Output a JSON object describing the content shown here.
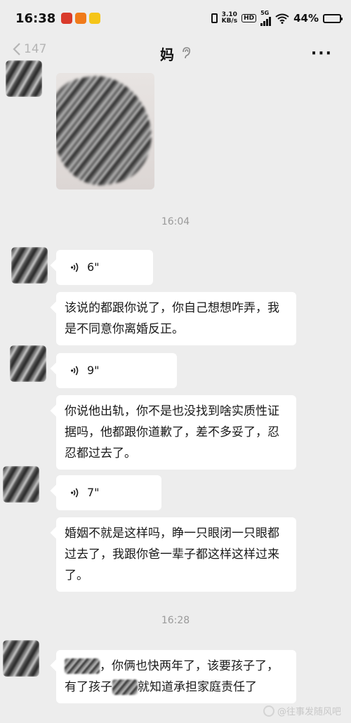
{
  "status_bar": {
    "time": "16:38",
    "net_speed_value": "3.10",
    "net_speed_unit": "KB/s",
    "hd_label": "HD",
    "network_label": "5G",
    "battery_percent": "44%",
    "battery_level": 0.44,
    "battery_color": "#e8a000"
  },
  "nav": {
    "back_count": "147",
    "title": "妈",
    "more_icon": "more-dots-icon",
    "ear_icon": "earpiece-mode-icon"
  },
  "messages": {
    "time1": "16:04",
    "voice1_duration": "6\"",
    "text1": "该说的都跟你说了，你自己想想咋弄，我是不同意你离婚反正。",
    "voice2_duration": "9\"",
    "text2": "你说他出轨，你不是也没找到啥实质性证据吗，他都跟你道歉了，差不多妥了，忍忍都过去了。",
    "voice3_duration": "7\"",
    "text3": "婚姻不就是这样吗，睁一只眼闭一只眼都过去了，我跟你爸一辈子都这样这样过来了。",
    "time2": "16:28",
    "text4_part1": "，你俩也快两年了，该要孩子了，有了孩子",
    "text4_part2": "就知道承担家庭责任了"
  },
  "watermark": {
    "text": "@往事发随风吧"
  },
  "colors": {
    "background": "#ededed",
    "bubble": "#ffffff",
    "timestamp": "#9a9a9a"
  }
}
